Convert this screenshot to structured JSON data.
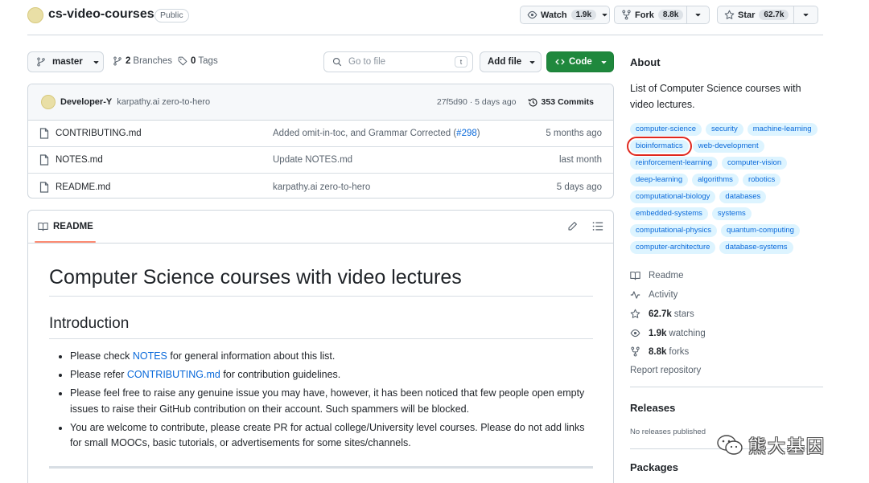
{
  "repo": {
    "name": "cs-video-courses",
    "visibility": "Public"
  },
  "header_actions": {
    "watch": {
      "label": "Watch",
      "count": "1.9k"
    },
    "fork": {
      "label": "Fork",
      "count": "8.8k"
    },
    "star": {
      "label": "Star",
      "count": "62.7k"
    }
  },
  "toolbar": {
    "branch": "master",
    "branches_count": "2",
    "branches_label": "Branches",
    "tags_count": "0",
    "tags_label": "Tags",
    "go_to_file_placeholder": "Go to file",
    "go_to_file_key": "t",
    "add_file": "Add file",
    "code": "Code"
  },
  "latest_commit": {
    "author": "Developer-Y",
    "message": "karpathy.ai zero-to-hero",
    "hash_time": "27f5d90 · 5 days ago",
    "commits_count": "353",
    "commits_label": "Commits"
  },
  "files": [
    {
      "name": "CONTRIBUTING.md",
      "message_prefix": "Added omit-in-toc, and Grammar Corrected (",
      "pr": "#298",
      "message_suffix": ")",
      "age": "5 months ago"
    },
    {
      "name": "NOTES.md",
      "message_prefix": "Update NOTES.md",
      "pr": "",
      "message_suffix": "",
      "age": "last month"
    },
    {
      "name": "README.md",
      "message_prefix": "karpathy.ai zero-to-hero",
      "pr": "",
      "message_suffix": "",
      "age": "5 days ago"
    }
  ],
  "readme": {
    "tab": "README",
    "title": "Computer Science courses with video lectures",
    "intro_heading": "Introduction",
    "bullets": [
      {
        "pre": "Please check ",
        "link": "NOTES",
        "post": " for general information about this list."
      },
      {
        "pre": "Please refer ",
        "link": "CONTRIBUTING.md",
        "post": " for contribution guidelines."
      },
      {
        "pre": "Please feel free to raise any genuine issue you may have, however, it has been noticed that few people open empty issues to raise their GitHub contribution on their account. Such spammers will be blocked.",
        "link": "",
        "post": ""
      },
      {
        "pre": "You are welcome to contribute, please create PR for actual college/University level courses. Please do not add links for small MOOCs, basic tutorials, or advertisements for some sites/channels.",
        "link": "",
        "post": ""
      }
    ]
  },
  "about": {
    "heading": "About",
    "description": "List of Computer Science courses with video lectures.",
    "topics": [
      "computer-science",
      "security",
      "machine-learning",
      "bioinformatics",
      "web-development",
      "reinforcement-learning",
      "computer-vision",
      "deep-learning",
      "algorithms",
      "robotics",
      "computational-biology",
      "databases",
      "embedded-systems",
      "systems",
      "computational-physics",
      "quantum-computing",
      "computer-architecture",
      "database-systems"
    ],
    "highlighted_topic": "bioinformatics",
    "highlight_color": "#e0281e",
    "readme_link": "Readme",
    "activity_link": "Activity",
    "stars_value": "62.7k",
    "stars_label": "stars",
    "watching_value": "1.9k",
    "watching_label": "watching",
    "forks_value": "8.8k",
    "forks_label": "forks",
    "report": "Report repository"
  },
  "releases": {
    "heading": "Releases",
    "empty_text": "No releases published"
  },
  "packages": {
    "heading": "Packages"
  },
  "watermark": {
    "text": "熊大基因"
  },
  "colors": {
    "accent": "#0969da",
    "code_button": "#1f883d",
    "topic_bg": "#ddf4ff",
    "readme_tab_underline": "#fd8c73"
  }
}
